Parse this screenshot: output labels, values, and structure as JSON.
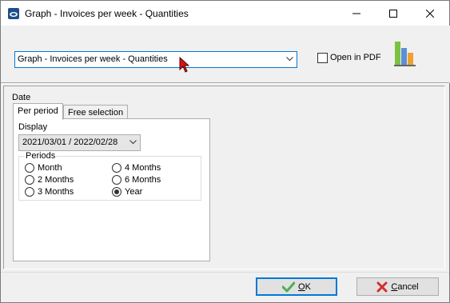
{
  "window": {
    "title": "Graph - Invoices per week - Quantities",
    "controls": {
      "minimize": "minimize-icon",
      "maximize": "maximize-icon",
      "close": "close-icon"
    }
  },
  "top": {
    "report_select": {
      "value": "Graph - Invoices per week - Quantities"
    },
    "open_in_pdf": {
      "label": "Open in PDF",
      "checked": false
    },
    "graph_icon": "bar-chart-icon"
  },
  "main": {
    "date_label": "Date",
    "tabs": [
      {
        "label": "Per period",
        "active": true
      },
      {
        "label": "Free selection",
        "active": false
      }
    ],
    "display_label": "Display",
    "display_value": "2021/03/01 / 2022/02/28",
    "periods_title": "Periods",
    "periods": [
      {
        "label": "Month",
        "selected": false
      },
      {
        "label": "4 Months",
        "selected": false
      },
      {
        "label": "2 Months",
        "selected": false
      },
      {
        "label": "6 Months",
        "selected": false
      },
      {
        "label": "3 Months",
        "selected": false
      },
      {
        "label": "Year",
        "selected": true
      }
    ]
  },
  "footer": {
    "ok_label": "OK",
    "cancel_label": "Cancel"
  },
  "colors": {
    "accent": "#0078d7",
    "ok_check": "#4caf50",
    "cancel_x": "#d32f2f"
  }
}
